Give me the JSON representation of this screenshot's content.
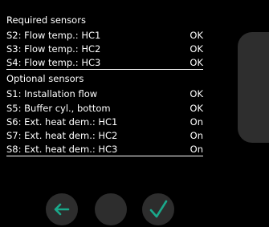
{
  "sections": {
    "required_title": "Required sensors",
    "optional_title": "Optional sensors"
  },
  "required_sensors": [
    {
      "label": "S2: Flow temp.: HC1",
      "status": "OK"
    },
    {
      "label": "S3: Flow temp.: HC2",
      "status": "OK"
    },
    {
      "label": "S4: Flow temp.: HC3",
      "status": "OK"
    }
  ],
  "optional_sensors": [
    {
      "label": "S1: Installation flow",
      "status": "OK"
    },
    {
      "label": "S5: Buffer cyl., bottom",
      "status": "OK"
    },
    {
      "label": "S6: Ext. heat dem.: HC1",
      "status": "On"
    },
    {
      "label": "S7: Ext. heat dem.: HC2",
      "status": "On"
    },
    {
      "label": "S8: Ext. heat dem.: HC3",
      "status": "On"
    }
  ],
  "buttons": {
    "back_icon": "arrow-left-icon",
    "middle_icon": "blank-circle",
    "confirm_icon": "checkmark-icon"
  },
  "colors": {
    "background": "#000000",
    "text": "#ffffff",
    "accent": "#1aa98b",
    "button_bg": "#2d2d2d",
    "scrollbar": "#2e2e2e"
  }
}
